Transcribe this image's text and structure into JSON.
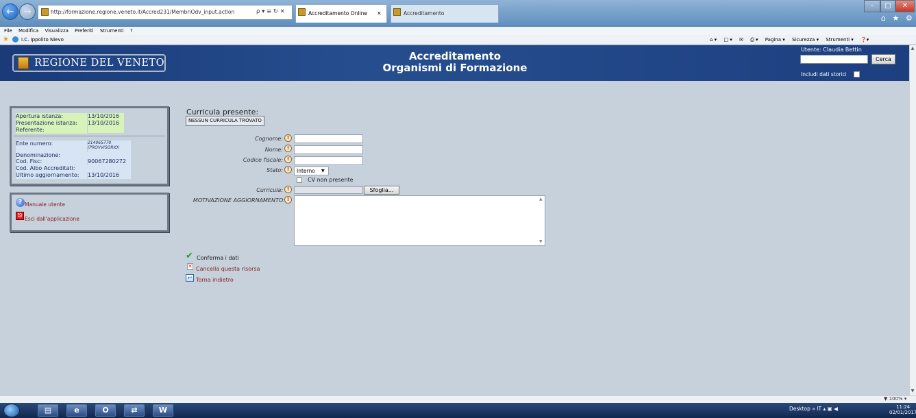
{
  "browser": {
    "url": "http://formazione.regione.veneto.it/Accred231/MembriOdv_input.action",
    "addr_controls": "ρ ▾ ≡ ↻ ✕",
    "tabs": [
      {
        "label": "Accreditamento Online",
        "close": "✕"
      },
      {
        "label": "Accreditamento"
      }
    ],
    "window_controls": {
      "min": "–",
      "max": "□",
      "close": "✕"
    },
    "toolbar_icons": "⌂ ★ ⚙",
    "menu": [
      "File",
      "Modifica",
      "Visualizza",
      "Preferiti",
      "Strumenti",
      "?"
    ],
    "favorite": "I.C. Ippolito Nievo",
    "command_bar": [
      "Pagina ▾",
      "Sicurezza ▾",
      "Strumenti ▾"
    ],
    "zoom": "▼ 100% ▾"
  },
  "header": {
    "logo_text": "REGIONE DEL VENETO",
    "title_line1": "Accreditamento",
    "title_line2": "Organismi di Formazione",
    "user": "Utente: Claudia Bettin",
    "search_value": "",
    "search_button": "Cerca",
    "history_label": "Includi dati storici"
  },
  "info": {
    "apertura_label": "Apertura istanza:",
    "apertura_value": "13/10/2016",
    "presentazione_label": "Presentazione istanza:",
    "presentazione_value": "13/10/2016",
    "referente_label": "Referente:",
    "referente_value": "",
    "ente_label": "Ente numero:",
    "ente_value": "214065770 (PROVVISORIO)",
    "denominazione_label": "Denominazione:",
    "codfisc_label": "Cod. Fisc:",
    "codfisc_value": "90067280272",
    "albo_label": "Cod. Albo Accreditati:",
    "ultimo_label": "Ultimo aggiornamento:",
    "ultimo_value": "13/10/2016"
  },
  "links": {
    "manual": "Manuale utente",
    "exit": "Esci dall'applicazione"
  },
  "form": {
    "curricula_title": "Curricula presente:",
    "no_curricula": "NESSUN CURRICULA TROVATO",
    "cognome_label": "Cognome:",
    "nome_label": "Nome:",
    "cf_label": "Codice fiscale:",
    "stato_label": "Stato:",
    "stato_value": "Interno",
    "cv_label": "CV non presente",
    "curricula_label": "Curricula:",
    "browse": "Sfoglia...",
    "motivazione_label": "MOTIVAZIONE AGGIORNAMENTO:",
    "info_icon": "!"
  },
  "actions": {
    "confirm": "Conferma i dati",
    "delete": "Cancella questa risorsa",
    "back": "Torna indietro"
  },
  "taskbar": {
    "apps": [
      "▤",
      "e",
      "O",
      "⇄",
      "W"
    ],
    "tray": "Desktop »  IT  ▴  ▣ ◀",
    "time": "11:24",
    "date": "02/01/2017"
  }
}
